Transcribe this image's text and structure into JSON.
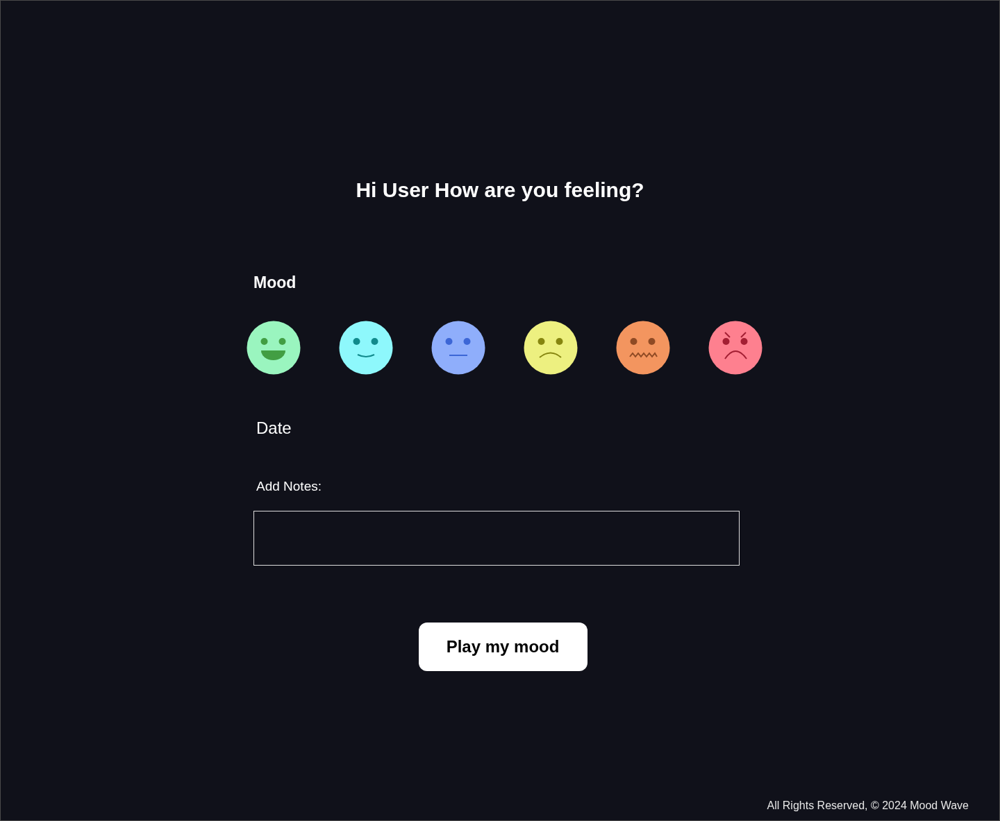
{
  "title": "Hi User How are you feeling?",
  "mood": {
    "label": "Mood",
    "faces": [
      {
        "kind": "grin",
        "color": "#9af5bf"
      },
      {
        "kind": "smile",
        "color": "#8ef8fc"
      },
      {
        "kind": "neutral",
        "color": "#8faefb"
      },
      {
        "kind": "sad",
        "color": "#edf080"
      },
      {
        "kind": "anxious",
        "color": "#f3955f"
      },
      {
        "kind": "angry",
        "color": "#fe808f"
      }
    ]
  },
  "date": {
    "label": "Date"
  },
  "notes": {
    "label": "Add Notes:"
  },
  "button": {
    "label": "Play my mood"
  },
  "footer": "All Rights Reserved, © 2024 Mood Wave"
}
